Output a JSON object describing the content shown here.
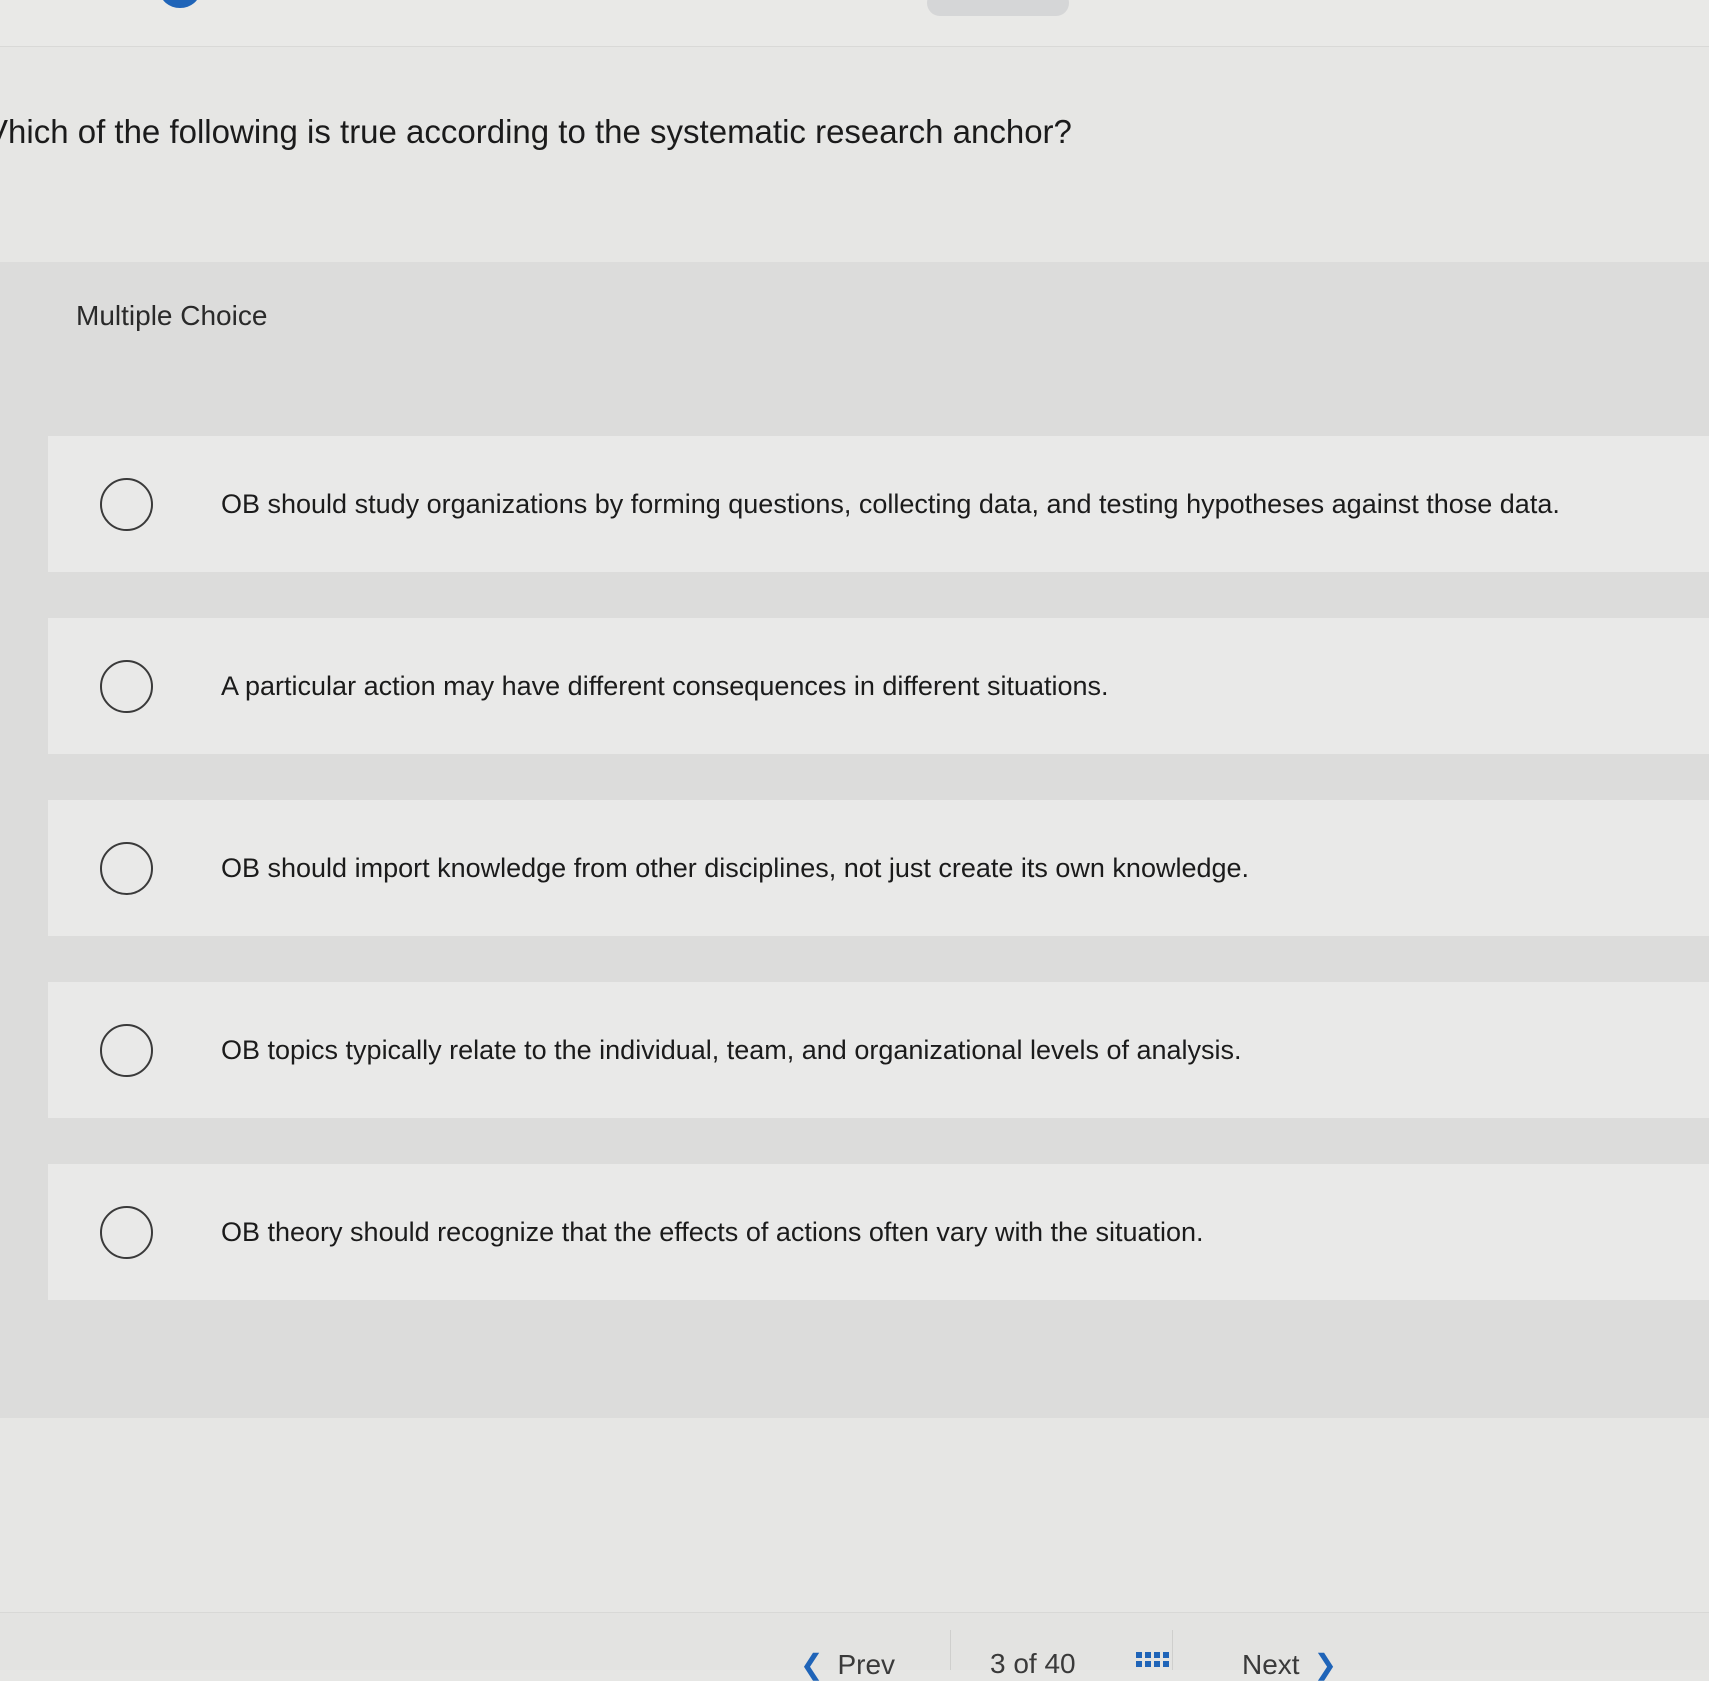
{
  "question": {
    "text": "Vhich of the following is true according to the systematic research anchor?"
  },
  "question_type": "Multiple Choice",
  "choices": [
    {
      "text": "OB should study organizations by forming questions, collecting data, and testing hypotheses against those data."
    },
    {
      "text": "A particular action may have different consequences in different situations."
    },
    {
      "text": "OB should import knowledge from other disciplines, not just create its own knowledge."
    },
    {
      "text": "OB topics typically relate to the individual, team, and organizational levels of analysis."
    },
    {
      "text": "OB theory should recognize that the effects of actions often vary with the situation."
    }
  ],
  "footer": {
    "prev_label": "Prev",
    "page_indicator": "3 of 40",
    "next_label": "Next"
  },
  "colors": {
    "accent": "#1f64b8",
    "panel": "#dcdcdb",
    "choice_bg": "#e9e9e8"
  }
}
